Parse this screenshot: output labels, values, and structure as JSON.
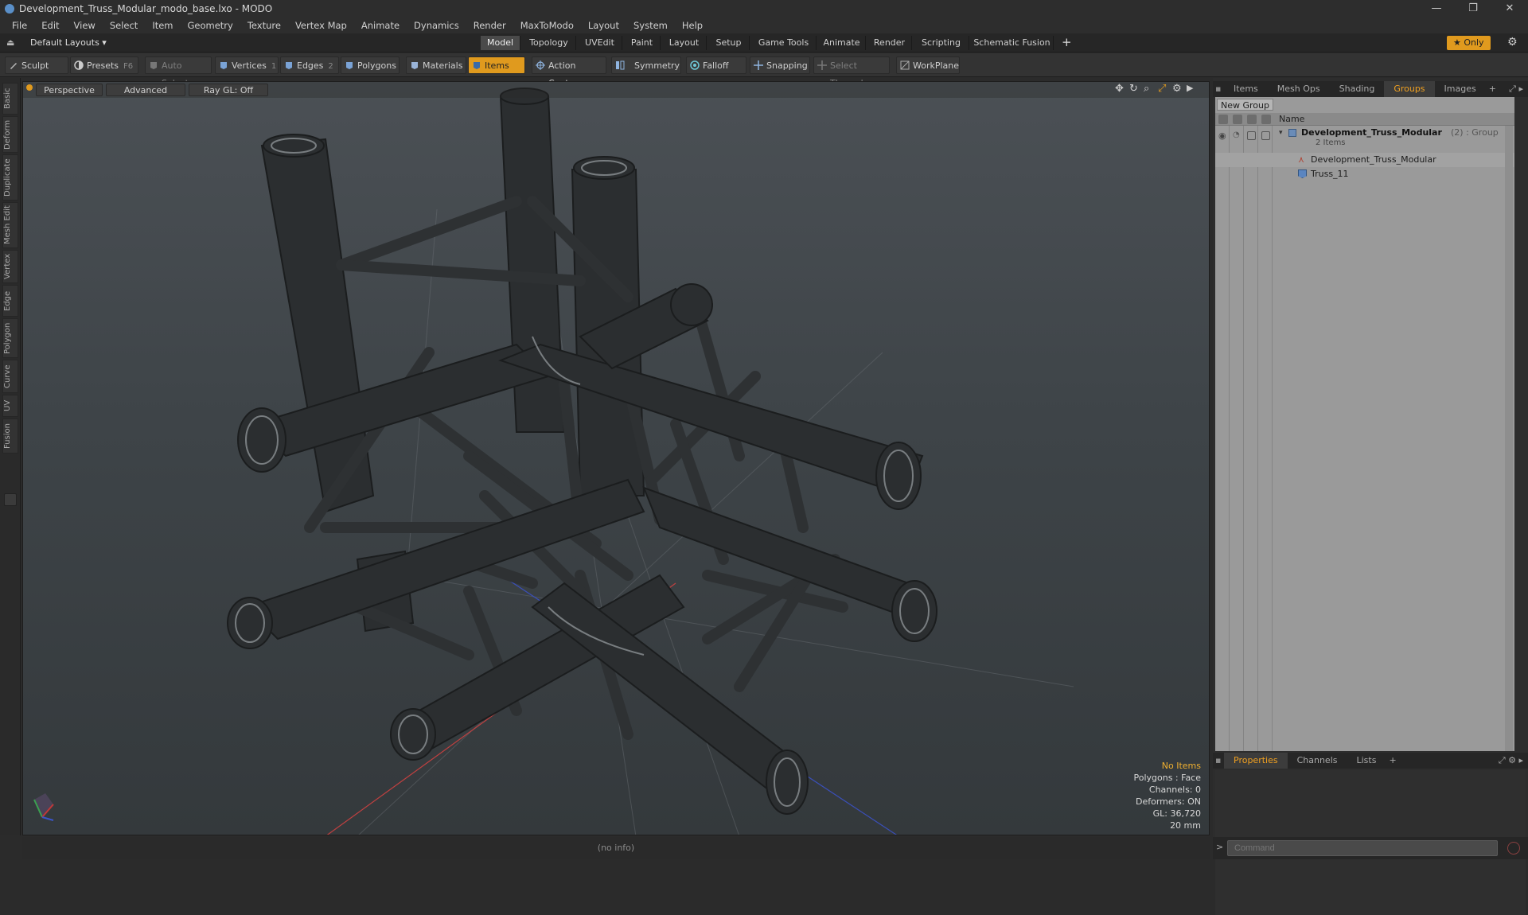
{
  "window": {
    "title": "Development_Truss_Modular_modo_base.lxo - MODO",
    "minimize": "—",
    "restore": "❐",
    "close": "✕"
  },
  "menu": [
    "File",
    "Edit",
    "View",
    "Select",
    "Item",
    "Geometry",
    "Texture",
    "Vertex Map",
    "Animate",
    "Dynamics",
    "Render",
    "MaxToModo",
    "Layout",
    "System",
    "Help"
  ],
  "layoutbar": {
    "layout_selector": "Default Layouts ▾",
    "tabs": [
      "Model",
      "Topology",
      "UVEdit",
      "Paint",
      "Layout",
      "Setup",
      "Game Tools",
      "Animate",
      "Render",
      "Scripting",
      "Schematic Fusion"
    ],
    "active_tab": "Model",
    "add": "+",
    "only_label": "★  Only"
  },
  "toolbar": {
    "sculpt": "Sculpt",
    "presets": "Presets",
    "presets_key": "F6",
    "auto_select": "Auto Select",
    "vertices": "Vertices",
    "vertices_count": "1",
    "edges": "Edges",
    "edges_count": "2",
    "polygons": "Polygons",
    "materials": "Materials",
    "items": "Items",
    "action_center": "Action Center",
    "symmetry": "Symmetry",
    "falloff": "Falloff",
    "snapping": "Snapping",
    "select_through": "Select Through",
    "workplane": "WorkPlane"
  },
  "left_tabs": [
    "Basic",
    "Deform",
    "Duplicate",
    "Mesh Edit",
    "Vertex",
    "Edge",
    "Polygon",
    "Curve",
    "UV",
    "Fusion"
  ],
  "viewport": {
    "view_mode": "Perspective",
    "shading": "Advanced",
    "raygl": "Ray GL: Off",
    "info": {
      "no_items": "No Items",
      "polygons": "Polygons : Face",
      "channels": "Channels: 0",
      "deformers": "Deformers: ON",
      "gl": "GL: 36,720",
      "scale": "20 mm"
    }
  },
  "status": "(no info)",
  "right_panel": {
    "top_tabs": [
      "Items",
      "Mesh Ops",
      "Shading",
      "Groups",
      "Images",
      "+"
    ],
    "active_top_tab": "Groups",
    "new_group": "New Group",
    "column_name": "Name",
    "tree": {
      "group_name": "Development_Truss_Modular",
      "group_suffix": "(2) : Group",
      "group_count": "2 Items",
      "children": [
        "Development_Truss_Modular",
        "Truss_11"
      ]
    },
    "bottom_tabs": [
      "Properties",
      "Channels",
      "Lists",
      "+"
    ],
    "active_bottom_tab": "Properties",
    "command_placeholder": "Command"
  },
  "colors": {
    "accent": "#e09a1e",
    "active_tab_text": "#f0a020",
    "viewport_top": "#4b5055",
    "viewport_bottom": "#34393c"
  }
}
